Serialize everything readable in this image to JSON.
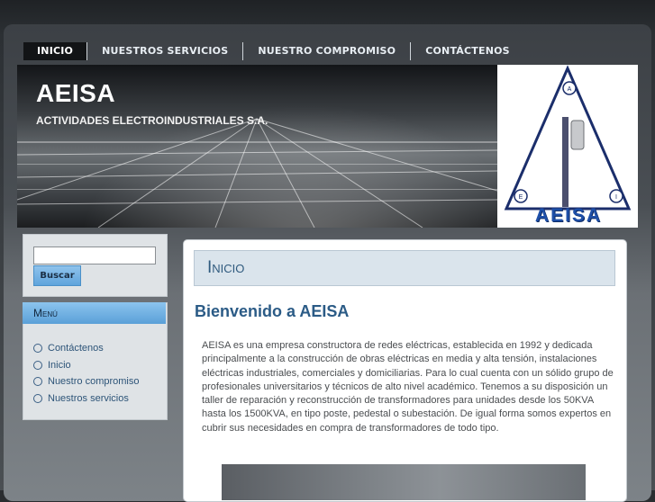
{
  "nav": {
    "items": [
      {
        "label": "INICIO",
        "active": true
      },
      {
        "label": "NUESTROS SERVICIOS",
        "active": false
      },
      {
        "label": "NUESTRO COMPROMISO",
        "active": false
      },
      {
        "label": "CONTÁCTENOS",
        "active": false
      }
    ]
  },
  "header": {
    "title": "AEISA",
    "subtitle": "ACTIVIDADES ELECTROINDUSTRIALES S.A.",
    "logo": {
      "word": "AEISA",
      "badges": [
        "A",
        "E",
        "I"
      ],
      "color": "#1e4fa8"
    }
  },
  "search": {
    "placeholder": "",
    "value": "",
    "button_label": "Buscar"
  },
  "menu": {
    "title": "Menú",
    "items": [
      "Contáctenos",
      "Inicio",
      "Nuestro compromiso",
      "Nuestros servicios"
    ]
  },
  "content": {
    "page_title": "Inicio",
    "heading": "Bienvenido a AEISA",
    "body": "AEISA es una empresa constructora de redes eléctricas, establecida en 1992 y dedicada principalmente a la construcción de obras eléctricas en media y alta tensión, instalaciones eléctricas industriales, comerciales y domiciliarias. Para lo cual cuenta con un sólido grupo de profesionales universitarios y técnicos de alto nivel académico. Tenemos a su disposición un taller de reparación y reconstrucción de transformadores para unidades desde los 50KVA hasta los 1500KVA, en tipo poste, pedestal o subestación. De igual forma somos expertos en cubrir sus necesidades en compra de transformadores de todo tipo."
  },
  "colors": {
    "accent": "#5fa4dc",
    "link": "#2d5478",
    "heading": "#2b5b86"
  }
}
